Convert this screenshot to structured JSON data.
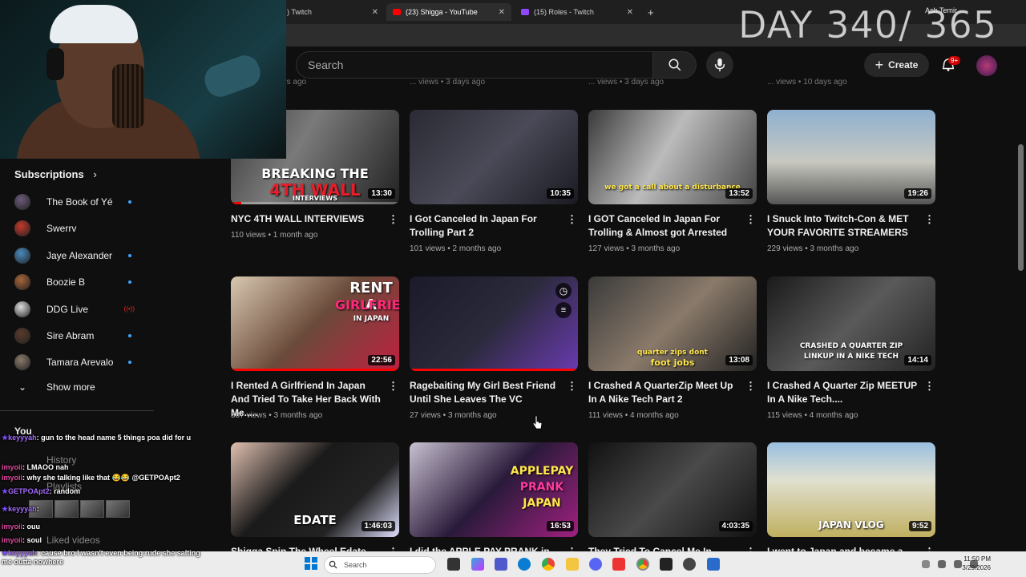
{
  "browser": {
    "tabs": [
      {
        "label": ") Twitch",
        "active": false
      },
      {
        "label": "(23) Shigga - YouTube",
        "active": true
      },
      {
        "label": "(15) Roles - Twitch",
        "active": false
      }
    ],
    "new_tab": "+",
    "profile_name": "Ash Temir"
  },
  "overlay": {
    "day_counter": "DAY 340/ 365"
  },
  "header": {
    "search_placeholder": "Search",
    "create_label": "Create",
    "notification_count": "9+"
  },
  "top_partial_meta": [
    "... views • 2 days ago",
    "... views • 3 days ago",
    "... views • 3 days ago",
    "... views • 10 days ago"
  ],
  "sidebar": {
    "subscriptions_title": "Subscriptions",
    "subscriptions": [
      {
        "name": "The Book of Yé",
        "status": "new",
        "color": "#6b5a7a"
      },
      {
        "name": "Swerrv",
        "status": "",
        "color": "#c23a2a"
      },
      {
        "name": "Jaye Alexander",
        "status": "new",
        "color": "#4a8abf"
      },
      {
        "name": "Boozie B",
        "status": "new",
        "color": "#a8653a"
      },
      {
        "name": "DDG Live",
        "status": "live",
        "color": "#dcdcdc"
      },
      {
        "name": "Sire Abram",
        "status": "new",
        "color": "#5a3a2a"
      },
      {
        "name": "Tamara Arevalo",
        "status": "new",
        "color": "#8a7a6a"
      }
    ],
    "show_more": "Show more",
    "you_label": "You",
    "history_label": "History",
    "playlists_label": "Playlists",
    "liked_label": "Liked videos"
  },
  "chat": [
    {
      "user": "keyyyah",
      "text": "gun to the head name 5 things poa did for u",
      "star": true
    },
    {
      "user": "imyoii",
      "text": "LMAOO nah",
      "star": false
    },
    {
      "user": "imyoii",
      "text": "why she talking like that 😂😂 @GETPOApt2",
      "star": false
    },
    {
      "user": "GETPOApt2",
      "text": "random",
      "star": true
    },
    {
      "user": "keyyyah",
      "text": "",
      "star": true
    },
    {
      "user": "imyoii",
      "text": "ouu",
      "star": false
    },
    {
      "user": "imyoii",
      "text": "soul",
      "star": false
    },
    {
      "user": "keyyyah",
      "text": "cause bro I wasn't even being rude she salting me outta nowhere",
      "star": true
    }
  ],
  "videos": [
    {
      "title": "NYC 4TH WALL INTERVIEWS",
      "views": "110 views",
      "age": "1 month ago",
      "duration": "13:30",
      "progress": 0.06,
      "thumb_text": "BREAKING THE",
      "thumb_text2": "4TH WALL",
      "thumb_text3": "INTERVIEWS"
    },
    {
      "title": "I Got Canceled In Japan For Trolling Part 2",
      "views": "101 views",
      "age": "2 months ago",
      "duration": "10:35",
      "progress": 0.0,
      "thumb_text": "",
      "thumb_text2": "",
      "thumb_text3": ""
    },
    {
      "title": "I GOT Canceled In Japan For Trolling & Almost got Arrested",
      "views": "127 views",
      "age": "3 months ago",
      "duration": "13:52",
      "progress": 0.0,
      "thumb_text": "we got a call about a disturbance",
      "thumb_text2": "",
      "thumb_text3": ""
    },
    {
      "title": "I Snuck Into Twitch-Con & MET YOUR FAVORITE STREAMERS",
      "views": "229 views",
      "age": "3 months ago",
      "duration": "19:26",
      "progress": 0.0,
      "thumb_text": "",
      "thumb_text2": "",
      "thumb_text3": ""
    },
    {
      "title": "I Rented A Girlfriend In Japan And Tried To Take Her Back With Me.....",
      "views": "387 views",
      "age": "3 months ago",
      "duration": "22:56",
      "progress": 1.0,
      "thumb_text": "RENT A",
      "thumb_text2": "GIRLFRIEND",
      "thumb_text3": "IN JAPAN"
    },
    {
      "title": "Ragebaiting My Girl Best Friend Until She Leaves The VC",
      "views": "27 views",
      "age": "3 months ago",
      "duration": "",
      "progress": 1.0,
      "thumb_text": "",
      "thumb_text2": "",
      "thumb_text3": ""
    },
    {
      "title": "I Crashed A QuarterZip Meet Up In A Nike Tech Part 2",
      "views": "111 views",
      "age": "4 months ago",
      "duration": "13:08",
      "progress": 0.0,
      "thumb_text": "quarter zips dont",
      "thumb_text2": "foot jobs",
      "thumb_text3": ""
    },
    {
      "title": "I Crashed A Quarter Zip MEETUP In A Nike Tech....",
      "views": "115 views",
      "age": "4 months ago",
      "duration": "14:14",
      "progress": 0.0,
      "thumb_text": "CRASHED A QUARTER ZIP",
      "thumb_text2": "LINKUP IN A NIKE TECH",
      "thumb_text3": ""
    },
    {
      "title": "Shigga Spin The Wheel Edate Ft...",
      "views": "",
      "age": "",
      "duration": "1:46:03",
      "progress": 0.0,
      "thumb_text": "EDATE",
      "thumb_text2": "",
      "thumb_text3": ""
    },
    {
      "title": "I did the APPLE PAY PRANK in...",
      "views": "",
      "age": "",
      "duration": "16:53",
      "progress": 0.0,
      "thumb_text": "APPLEPAY",
      "thumb_text2": "PRANK",
      "thumb_text3": "JAPAN"
    },
    {
      "title": "They Tried To Cancel Me In Japan...",
      "views": "",
      "age": "",
      "duration": "4:03:35",
      "progress": 0.0,
      "thumb_text": "",
      "thumb_text2": "",
      "thumb_text3": ""
    },
    {
      "title": "I went to Japan and became a...",
      "views": "",
      "age": "",
      "duration": "9:52",
      "progress": 0.0,
      "thumb_text": "JAPAN VLOG",
      "thumb_text2": "",
      "thumb_text3": ""
    }
  ],
  "taskbar": {
    "search_label": "Search",
    "time": "11:50 PM",
    "date": "3/29/2026"
  }
}
